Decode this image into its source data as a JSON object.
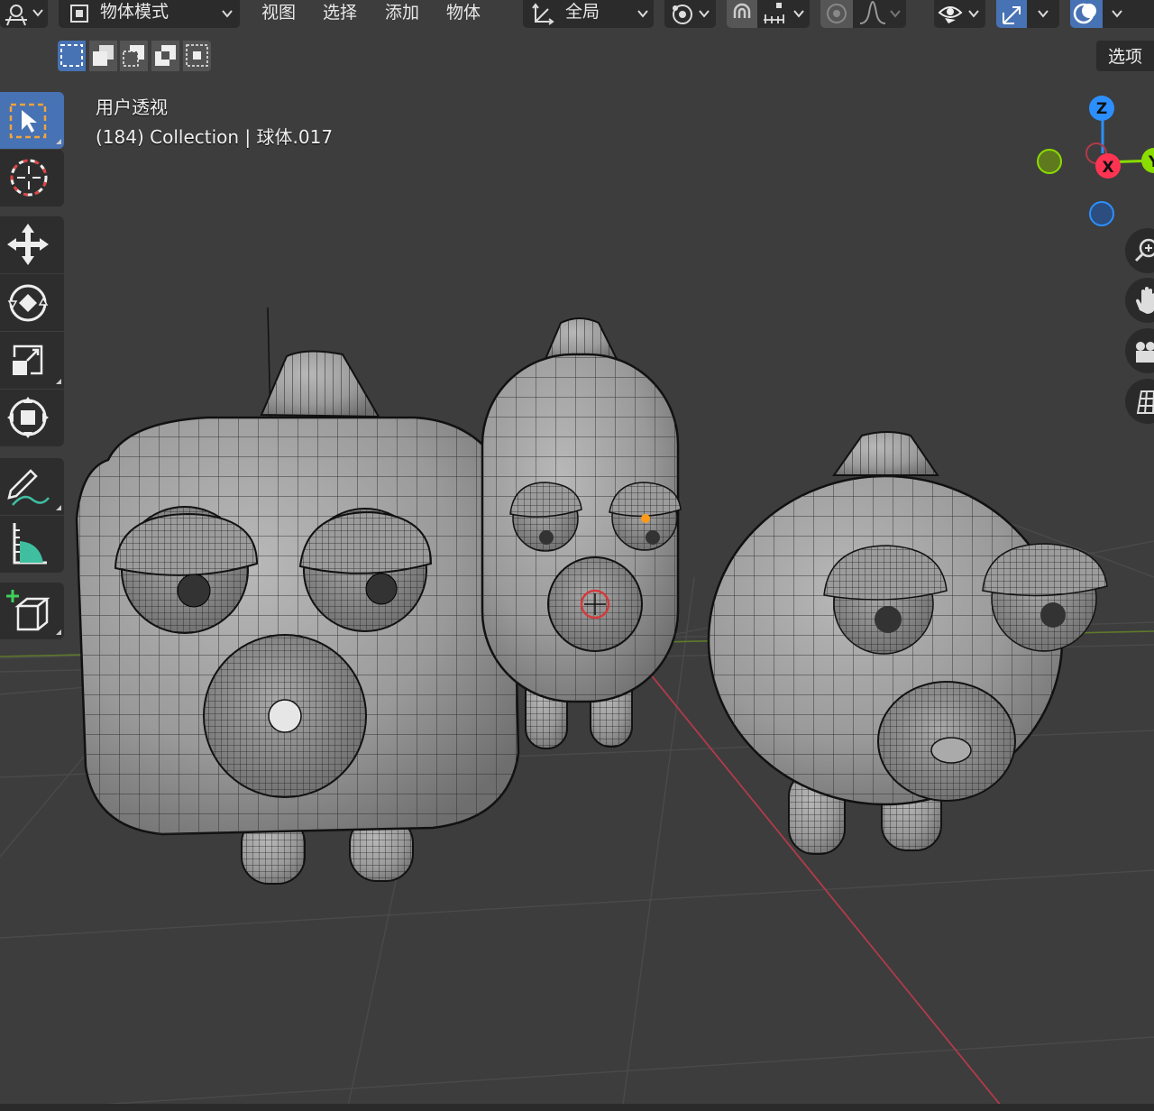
{
  "header": {
    "mode_label": "物体模式",
    "menus": [
      "视图",
      "选择",
      "添加",
      "物体"
    ],
    "transform_orientation": "全局",
    "options_label": "选项"
  },
  "icons": {
    "editor_type": "view3d-icon",
    "mode": "object-mode-icon",
    "orientation": "transform-orientation-icon",
    "pivot": "pivot-point-icon",
    "snap": "snap-magnet-icon",
    "snap_increment": "snap-increment-icon",
    "proportional": "proportional-edit-icon",
    "falloff": "falloff-curve-icon",
    "visibility": "eye-icon",
    "gizmo": "gizmo-icon",
    "overlay": "overlay-icon",
    "tools": [
      "select-box-icon",
      "cursor-icon",
      "move-icon",
      "rotate-icon",
      "scale-icon",
      "transform-icon",
      "annotate-icon",
      "measure-icon",
      "add-cube-icon"
    ],
    "nav": [
      "zoom-icon",
      "pan-hand-icon",
      "camera-icon",
      "ortho-grid-icon"
    ],
    "select_modes": [
      "select-new-icon",
      "select-extend-icon",
      "select-subtract-icon",
      "select-invert-icon",
      "select-intersect-icon"
    ]
  },
  "viewport": {
    "view_name": "用户透视",
    "info_line": "(184) Collection | 球体.017"
  },
  "gizmo_axes": {
    "z": "Z",
    "x": "X",
    "y": "Y"
  },
  "colors": {
    "accent_blue": "#4772b3",
    "axis_x": "#ff3352",
    "axis_y": "#8bdc00",
    "axis_z": "#2c8fff",
    "viewport_bg": "#3d3d3d",
    "header_bg": "#2b2b2b"
  }
}
